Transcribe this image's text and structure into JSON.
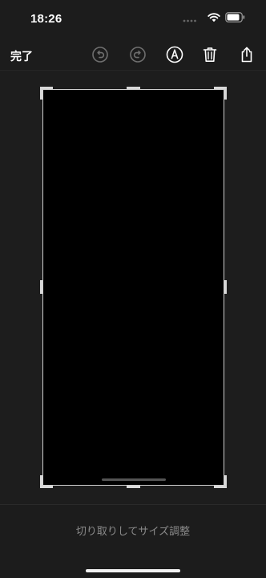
{
  "status": {
    "time": "18:26"
  },
  "toolbar": {
    "done_label": "完了",
    "icons": {
      "undo": "undo-icon",
      "redo": "redo-icon",
      "markup": "markup-pen-icon",
      "delete": "trash-icon",
      "share": "share-icon"
    }
  },
  "editor": {
    "crop_hint": "切り取りしてサイズ調整"
  },
  "colors": {
    "background": "#1c1c1c",
    "screenshot": "#000000",
    "handles": "#d8d8d8",
    "hint_text": "#8a8a8a",
    "disabled_icon": "#6e6e6e"
  }
}
